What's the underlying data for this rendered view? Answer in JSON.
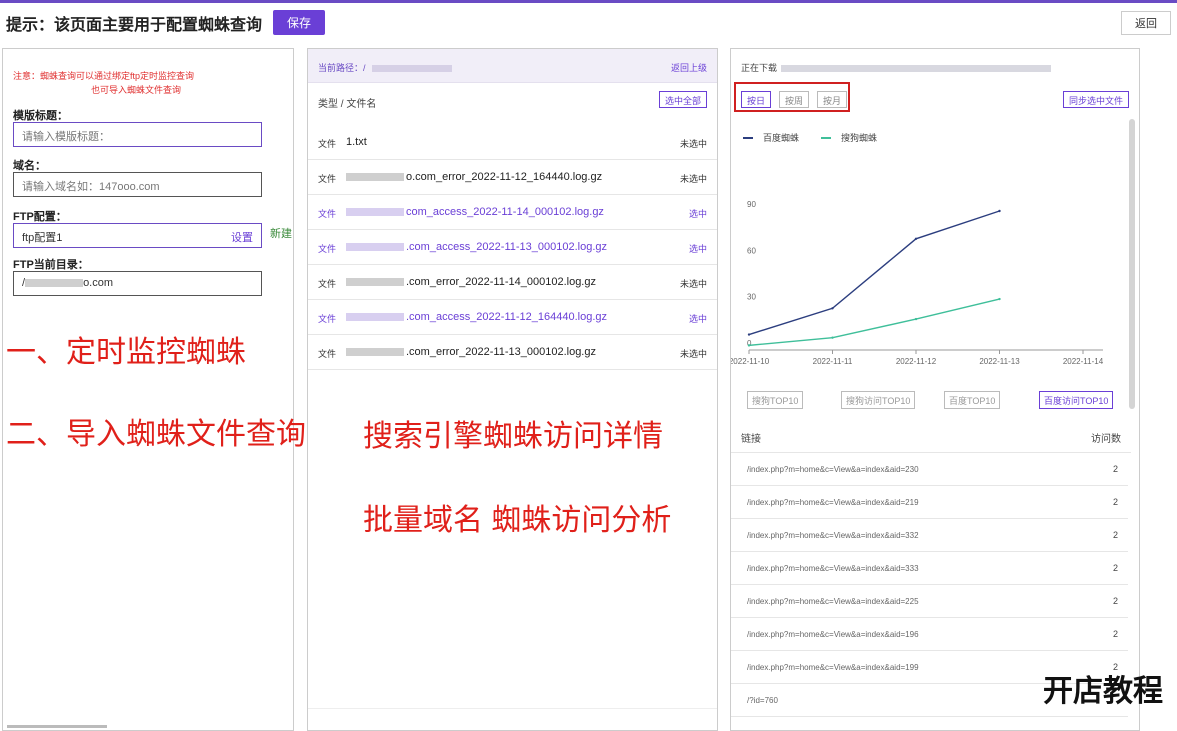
{
  "header": {
    "hint": "提示：该页面主要用于配置蜘蛛查询",
    "save_label": "保存",
    "back_label": "返回"
  },
  "left": {
    "note_line1": "注意：蜘蛛查询可以通过绑定ftp定时监控查询",
    "note_line2": "也可导入蜘蛛文件查询",
    "template_title_label": "模版标题：",
    "template_title_placeholder": "请输入模版标题：",
    "domain_label": "域名：",
    "domain_placeholder": "请输入域名如：147ooo.com",
    "ftp_label": "FTP配置：",
    "ftp_value": "ftp配置1",
    "ftp_set": "设置",
    "ftp_new": "新建",
    "ftp_dir_label": "FTP当前目录：",
    "ftp_dir_value": "/",
    "ftp_dir_suffix": "o.com"
  },
  "overlay": {
    "line1": "一、定时监控蜘蛛",
    "line2": "二、导入蜘蛛文件查询",
    "line3": "搜索引擎蜘蛛访问详情",
    "line4": "批量域名  蜘蛛访问分析"
  },
  "middle": {
    "current_path_label": "当前路径：",
    "current_path_value": "/",
    "up_label": "返回上级",
    "col_header": "类型 / 文件名",
    "select_all": "选中全部",
    "files": [
      {
        "type": "文件",
        "prefix": "",
        "name": "1.txt",
        "state": "未选中",
        "selected": false
      },
      {
        "type": "文件",
        "prefix": "blur",
        "name": "o.com_error_2022-11-12_164440.log.gz",
        "state": "未选中",
        "selected": false
      },
      {
        "type": "文件",
        "prefix": "blur",
        "name": "com_access_2022-11-14_000102.log.gz",
        "state": "选中",
        "selected": true
      },
      {
        "type": "文件",
        "prefix": "blur",
        "name": ".com_access_2022-11-13_000102.log.gz",
        "state": "选中",
        "selected": true
      },
      {
        "type": "文件",
        "prefix": "blur",
        "name": ".com_error_2022-11-14_000102.log.gz",
        "state": "未选中",
        "selected": false
      },
      {
        "type": "文件",
        "prefix": "blur",
        "name": ".com_access_2022-11-12_164440.log.gz",
        "state": "选中",
        "selected": true
      },
      {
        "type": "文件",
        "prefix": "blur",
        "name": ".com_error_2022-11-13_000102.log.gz",
        "state": "未选中",
        "selected": false
      }
    ]
  },
  "right": {
    "loading_label": "正在下载",
    "range_buttons": [
      {
        "label": "按日",
        "active": true
      },
      {
        "label": "按周",
        "active": false
      },
      {
        "label": "按月",
        "active": false
      }
    ],
    "sync_label": "同步选中文件",
    "top_buttons": [
      {
        "label": "搜狗TOP10",
        "active": false
      },
      {
        "label": "搜狗访问TOP10",
        "active": false
      },
      {
        "label": "百度TOP10",
        "active": false
      },
      {
        "label": "百度访问TOP10",
        "active": true
      }
    ],
    "table_header_link": "链接",
    "table_header_count": "访问数",
    "rows": [
      {
        "link": "/index.php?m=home&c=View&a=index&aid=230",
        "count": "2"
      },
      {
        "link": "/index.php?m=home&c=View&a=index&aid=219",
        "count": "2"
      },
      {
        "link": "/index.php?m=home&c=View&a=index&aid=332",
        "count": "2"
      },
      {
        "link": "/index.php?m=home&c=View&a=index&aid=333",
        "count": "2"
      },
      {
        "link": "/index.php?m=home&c=View&a=index&aid=225",
        "count": "2"
      },
      {
        "link": "/index.php?m=home&c=View&a=index&aid=196",
        "count": "2"
      },
      {
        "link": "/index.php?m=home&c=View&a=index&aid=199",
        "count": "2"
      },
      {
        "link": "/?id=760",
        "count": ""
      }
    ]
  },
  "colors": {
    "accent": "#6a3fd6",
    "series1": "#2c3e7f",
    "series2": "#3fbf9a",
    "annotation": "#e0201a"
  },
  "watermark": "开店教程",
  "chart_data": {
    "type": "line",
    "x": [
      "2022-11-10",
      "2022-11-11",
      "2022-11-12",
      "2022-11-13",
      "2022-11-14"
    ],
    "series": [
      {
        "name": "百度蜘蛛",
        "values": [
          10,
          27,
          72,
          90,
          null
        ]
      },
      {
        "name": "搜狗蜘蛛",
        "values": [
          3,
          8,
          20,
          33,
          null
        ]
      }
    ],
    "yticks": [
      0,
      30,
      60,
      90
    ],
    "ylim": [
      0,
      100
    ],
    "legend": "top-left",
    "grid": false
  }
}
